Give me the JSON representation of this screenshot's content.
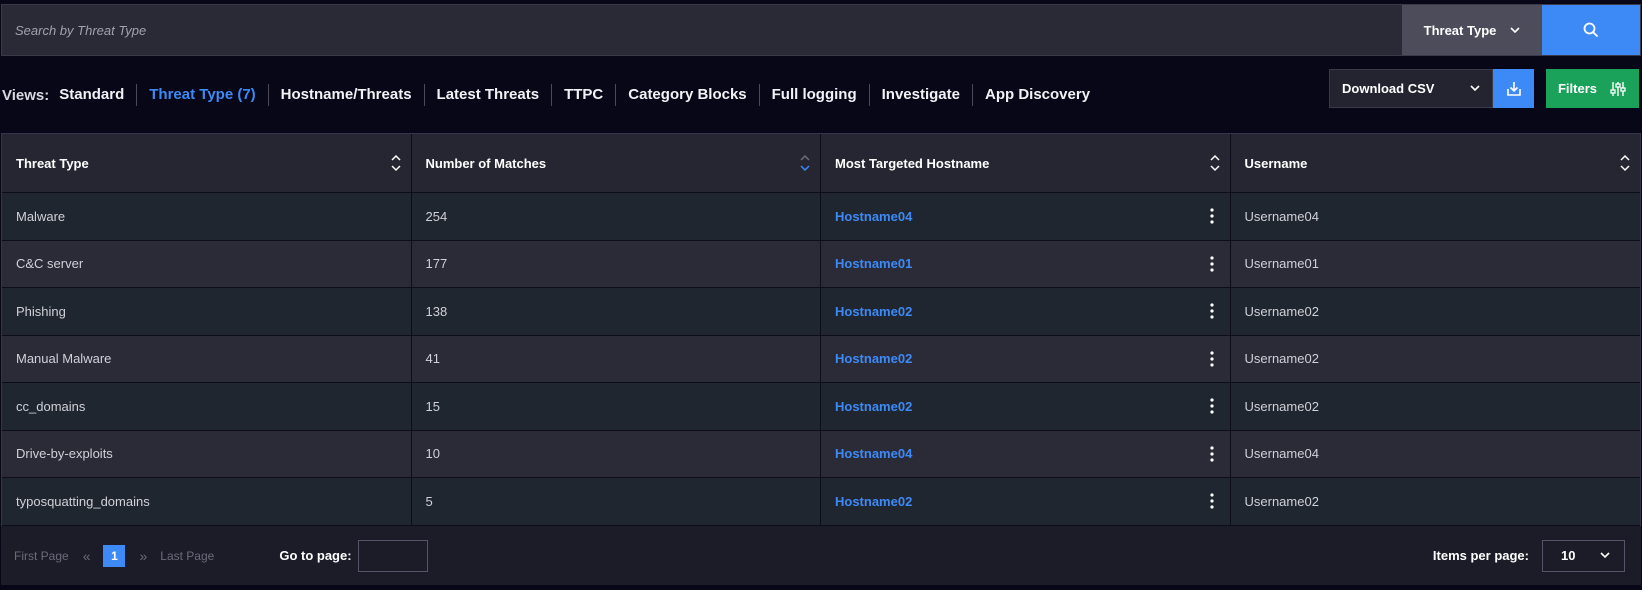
{
  "search": {
    "placeholder": "Search by Threat Type",
    "type_label": "Threat Type"
  },
  "views": {
    "label": "Views:",
    "items": [
      "Standard",
      "Threat Type (7)",
      "Hostname/Threats",
      "Latest Threats",
      "TTPC",
      "Category Blocks",
      "Full logging",
      "Investigate",
      "App Discovery"
    ],
    "active_index": 1
  },
  "toolbar": {
    "csv_label": "Download CSV",
    "filters_label": "Filters"
  },
  "table": {
    "columns": [
      "Threat Type",
      "Number of Matches",
      "Most Targeted Hostname",
      "Username"
    ],
    "rows": [
      {
        "threat": "Malware",
        "matches": "254",
        "hostname": "Hostname04",
        "username": "Username04"
      },
      {
        "threat": "C&C server",
        "matches": "177",
        "hostname": "Hostname01",
        "username": "Username01"
      },
      {
        "threat": "Phishing",
        "matches": "138",
        "hostname": "Hostname02",
        "username": "Username02"
      },
      {
        "threat": "Manual Malware",
        "matches": "41",
        "hostname": "Hostname02",
        "username": "Username02"
      },
      {
        "threat": "cc_domains",
        "matches": "15",
        "hostname": "Hostname02",
        "username": "Username02"
      },
      {
        "threat": "Drive-by-exploits",
        "matches": "10",
        "hostname": "Hostname04",
        "username": "Username04"
      },
      {
        "threat": "typosquatting_domains",
        "matches": "5",
        "hostname": "Hostname02",
        "username": "Username02"
      }
    ]
  },
  "pagination": {
    "first_label": "First Page",
    "last_label": "Last Page",
    "current_page": "1",
    "goto_label": "Go to page:",
    "items_per_page_label": "Items per page:",
    "items_per_page": "10"
  },
  "colors": {
    "accent": "#3d8af7",
    "success": "#1aa25a",
    "background": "#070717"
  }
}
